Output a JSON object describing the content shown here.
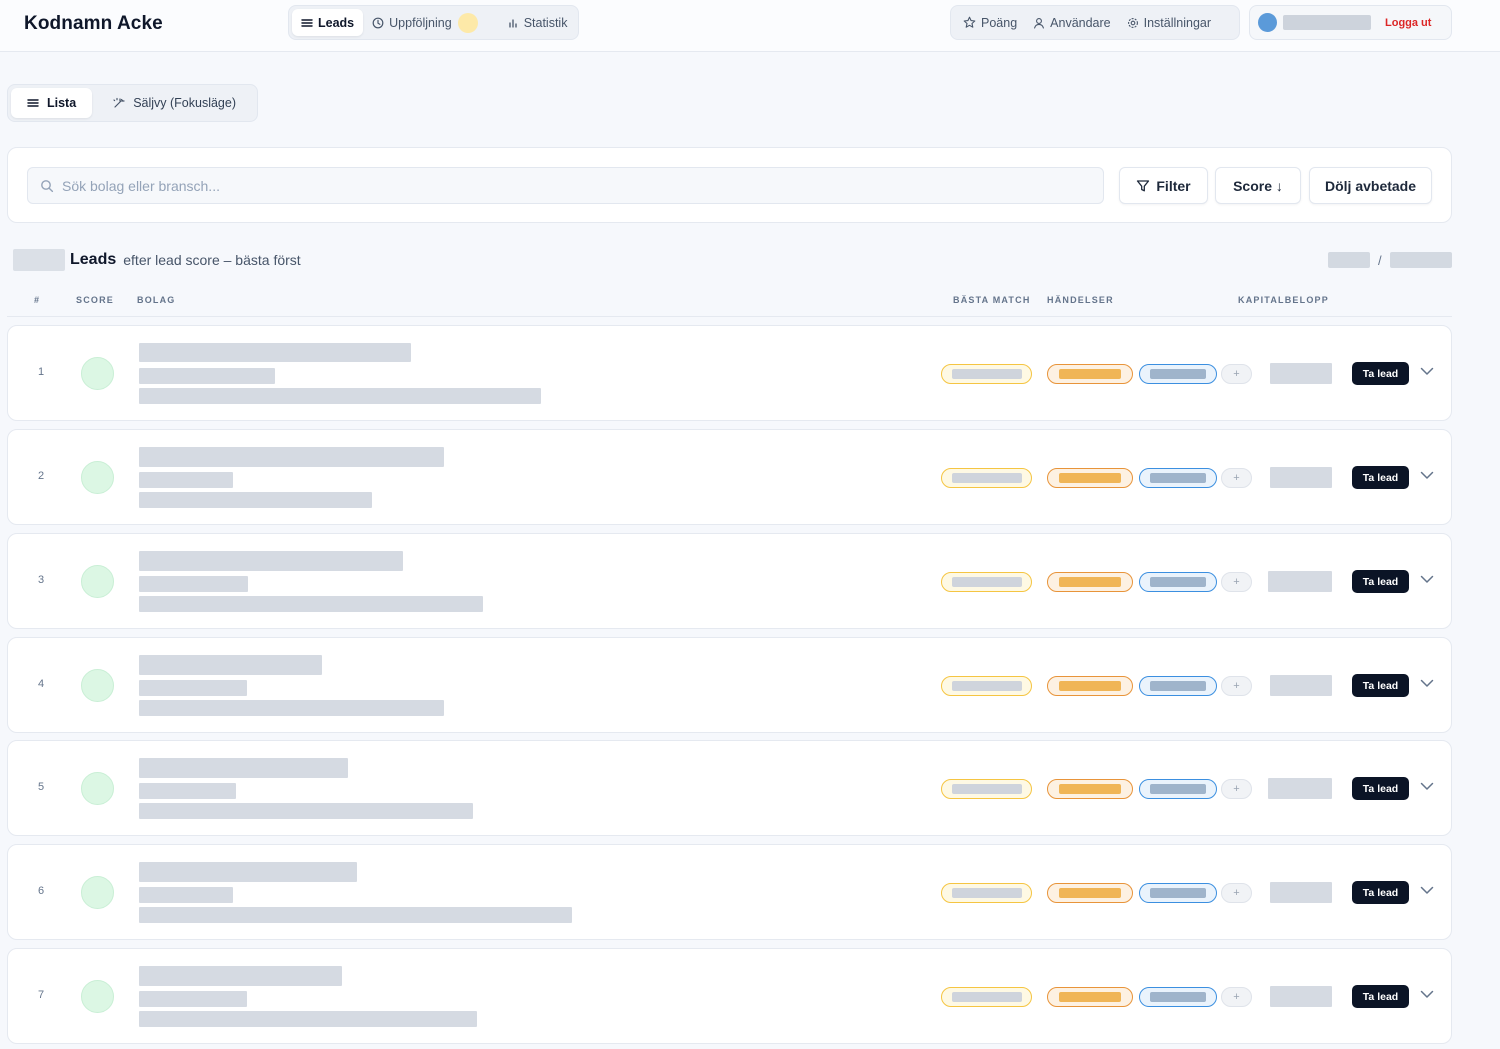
{
  "app": {
    "title": "Kodnamn Acke",
    "logout_label": "Logga ut"
  },
  "nav": {
    "leads_label": "Leads",
    "followup_label": "Uppföljning",
    "stats_label": "Statistik"
  },
  "rightnav": {
    "points_label": "Poäng",
    "users_label": "Användare",
    "settings_label": "Inställningar"
  },
  "viewtabs": {
    "list_label": "Lista",
    "sales_label": "Säljvy (Fokusläge)"
  },
  "search": {
    "placeholder": "Sök bolag eller bransch...",
    "filter_label": "Filter",
    "score_label": "Score ↓",
    "hide_label": "Dölj avbetade"
  },
  "leads": {
    "title": "Leads",
    "subtitle": "efter lead score – bästa först",
    "pager_sep": "/"
  },
  "columns": {
    "num": "#",
    "score": "SCORE",
    "company": "BOLAG",
    "best_match": "BÄSTA MATCH",
    "events": "HÄNDELSER",
    "capital": "KAPITALBELOPP"
  },
  "rows": [
    {
      "num": "1",
      "action_label": "Ta lead",
      "plus": "+"
    },
    {
      "num": "2",
      "action_label": "Ta lead",
      "plus": "+"
    },
    {
      "num": "3",
      "action_label": "Ta lead",
      "plus": "+"
    },
    {
      "num": "4",
      "action_label": "Ta lead",
      "plus": "+"
    },
    {
      "num": "5",
      "action_label": "Ta lead",
      "plus": "+"
    },
    {
      "num": "6",
      "action_label": "Ta lead",
      "plus": "+"
    },
    {
      "num": "7",
      "action_label": "Ta lead",
      "plus": "+"
    }
  ],
  "colors": {
    "accent_dark": "#0b1426",
    "logout": "#dc2626",
    "score_green": "#dcf7e4",
    "pill_yellow": "#f5c542",
    "pill_orange": "#e8943a",
    "pill_blue": "#3b8fe0"
  }
}
